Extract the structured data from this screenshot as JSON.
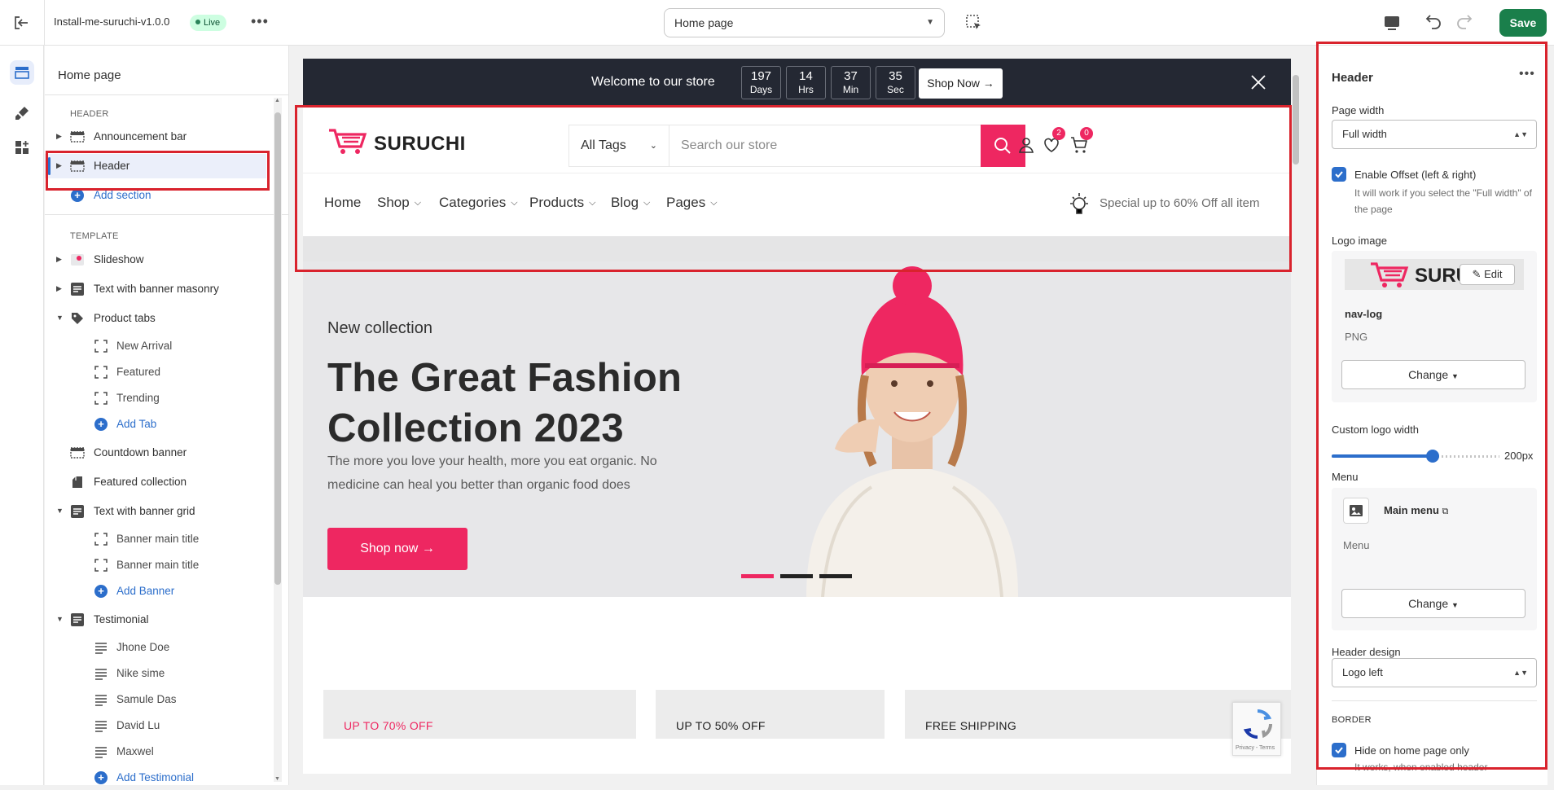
{
  "topbar": {
    "theme_name": "Install-me-suruchi-v1.0.0",
    "status_badge": "Live",
    "page_selector": "Home page",
    "save_label": "Save"
  },
  "sidebar": {
    "title": "Home page",
    "header_group": "HEADER",
    "header_items": [
      {
        "label": "Announcement bar"
      },
      {
        "label": "Header"
      }
    ],
    "add_section": "Add section",
    "template_group": "TEMPLATE",
    "template_items": [
      {
        "label": "Slideshow"
      },
      {
        "label": "Text with banner masonry"
      },
      {
        "label": "Product tabs"
      },
      {
        "label": "New Arrival"
      },
      {
        "label": "Featured"
      },
      {
        "label": "Trending"
      },
      {
        "label": "Add Tab"
      },
      {
        "label": "Countdown banner"
      },
      {
        "label": "Featured collection"
      },
      {
        "label": "Text with banner grid"
      },
      {
        "label": "Banner main title"
      },
      {
        "label": "Banner main title"
      },
      {
        "label": "Add Banner"
      },
      {
        "label": "Testimonial"
      },
      {
        "label": "Jhone Doe"
      },
      {
        "label": "Nike sime"
      },
      {
        "label": "Samule Das"
      },
      {
        "label": "David Lu"
      },
      {
        "label": "Maxwel"
      },
      {
        "label": "Add Testimonial"
      }
    ]
  },
  "preview": {
    "announcement": {
      "text": "Welcome to our store",
      "countdown": [
        {
          "value": "197",
          "unit": "Days"
        },
        {
          "value": "14",
          "unit": "Hrs"
        },
        {
          "value": "37",
          "unit": "Min"
        },
        {
          "value": "35",
          "unit": "Sec"
        }
      ],
      "button": "Shop Now"
    },
    "header": {
      "logo_text": "SURUCHI",
      "search_category": "All Tags",
      "search_placeholder": "Search our store",
      "wishlist_count": "2",
      "cart_count": "0"
    },
    "nav": {
      "items": [
        "Home",
        "Shop",
        "Categories",
        "Products",
        "Blog",
        "Pages"
      ],
      "promo": "Special up to 60% Off all item"
    },
    "hero": {
      "kicker": "New collection",
      "title": "The Great Fashion Collection 2023",
      "description": "The more you love your health, more you eat organic. No medicine can heal you better than organic food does",
      "button": "Shop now",
      "active_slide": 1,
      "slide_count": 3
    },
    "features": [
      "UP TO 70% OFF",
      "UP TO 50% OFF",
      "FREE SHIPPING"
    ],
    "recaptcha": "Privacy - Terms",
    "colors": {
      "accent": "#ee2761",
      "dark": "#242833"
    }
  },
  "settings": {
    "title": "Header",
    "page_width_label": "Page width",
    "page_width_value": "Full width",
    "enable_offset_label": "Enable Offset (left & right)",
    "enable_offset_help": "It will work if you select the \"Full width\" of the page",
    "logo_image_label": "Logo image",
    "logo_preview_text": "SURU",
    "logo_edit": "Edit",
    "logo_file_name": "nav-log",
    "logo_file_type": "PNG",
    "change_label": "Change",
    "custom_logo_width_label": "Custom logo width",
    "custom_logo_width_value": "200px",
    "custom_logo_width_fraction": 0.6,
    "menu_label": "Menu",
    "menu_name": "Main menu",
    "menu_sub": "Menu",
    "header_design_label": "Header design",
    "header_design_value": "Logo left",
    "border_group": "BORDER",
    "hide_on_home_label": "Hide on home page only",
    "hide_on_home_help": "It works, when enabled header"
  }
}
